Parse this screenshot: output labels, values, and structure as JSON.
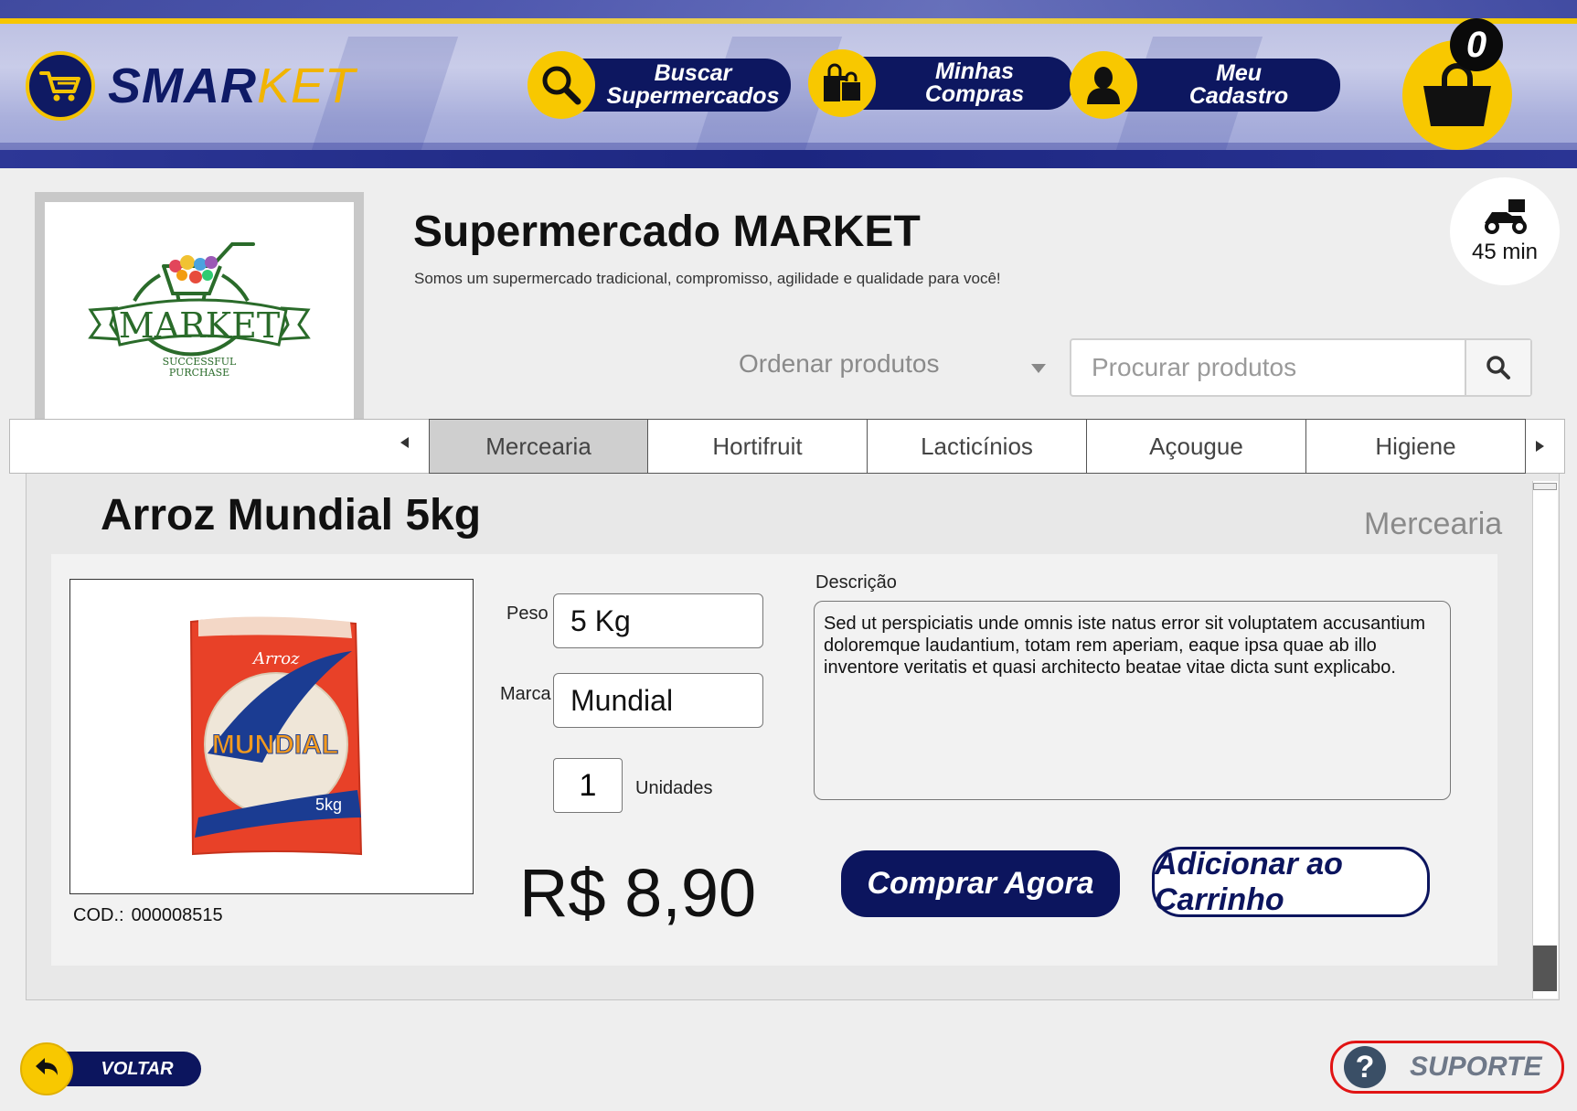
{
  "header": {
    "logo": {
      "text_main": "SMAR",
      "text_accent": "KET"
    },
    "nav": [
      {
        "id": "buscar",
        "line1": "Buscar",
        "line2": "Supermercados",
        "icon": "search-icon"
      },
      {
        "id": "compras",
        "line1": "Minhas",
        "line2": "Compras",
        "icon": "shopping-bag-icon"
      },
      {
        "id": "cadastro",
        "line1": "Meu",
        "line2": "Cadastro",
        "icon": "user-icon"
      }
    ],
    "cart": {
      "count": "0",
      "icon": "basket-icon"
    }
  },
  "store": {
    "logo": {
      "name": "MARKET",
      "tagline_1": "SUCCESSFUL",
      "tagline_2": "PURCHASE"
    },
    "name": "Supermercado MARKET",
    "description": "Somos um supermercado tradicional, compromisso, agilidade e qualidade para você!",
    "delivery_time": "45 min"
  },
  "toolbar": {
    "sort_label": "Ordenar produtos",
    "search_placeholder": "Procurar produtos"
  },
  "tabs": [
    {
      "label": "Mercearia",
      "active": true
    },
    {
      "label": "Hortifruit"
    },
    {
      "label": "Lacticínios"
    },
    {
      "label": "Açougue"
    },
    {
      "label": "Higiene"
    }
  ],
  "product": {
    "name": "Arroz Mundial 5kg",
    "category": "Mercearia",
    "image": {
      "brand": "MUNDIAL",
      "type": "Arroz",
      "size": "5kg"
    },
    "code_label": "COD.:",
    "code": "000008515",
    "weight_label": "Peso",
    "weight": "5 Kg",
    "brand_label": "Marca",
    "brand": "Mundial",
    "quantity": "1",
    "quantity_unit": "Unidades",
    "price": "R$ 8,90",
    "description_label": "Descrição",
    "description": "Sed ut perspiciatis unde omnis iste natus error sit voluptatem accusantium doloremque laudantium, totam rem aperiam, eaque ipsa quae ab illo inventore veritatis et quasi architecto beatae vitae dicta sunt explicabo.",
    "buy_label": "Comprar Agora",
    "add_label": "Adicionar ao Carrinho"
  },
  "footer": {
    "back_label": "VOLTAR",
    "support_label": "SUPORTE"
  },
  "colors": {
    "navy": "#0c155e",
    "yellow": "#f8c800",
    "support_red": "#e11414"
  }
}
